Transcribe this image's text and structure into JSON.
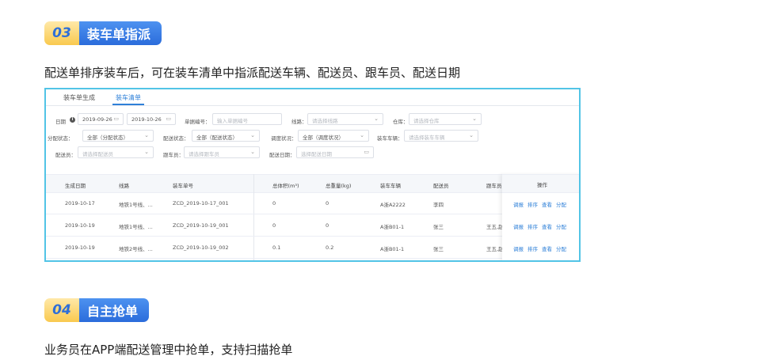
{
  "section3": {
    "num": "03",
    "title": "装车单指派",
    "desc": "配送单排序装车后，可在装车清单中指派配送车辆、配送员、跟车员、配送日期"
  },
  "screenshot": {
    "tabs": [
      "装车单生成",
      "装车清单"
    ],
    "active_tab": 1,
    "filters": {
      "date_label": "日期",
      "date_start": "2019-09-26",
      "date_end": "2019-10-26",
      "order_no_label": "单据编号：",
      "order_no_placeholder": "输入单据编号",
      "route_label": "线路：",
      "route_placeholder": "请选择线路",
      "warehouse_label": "仓库：",
      "warehouse_placeholder": "请选择仓库",
      "assign_status_label": "分配状态：",
      "assign_status_value": "全部（分配状态）",
      "delivery_status_label": "配送状态：",
      "delivery_status_value": "全部（配送状态）",
      "dispatch_status_label": "调度状况：",
      "dispatch_status_value": "全部（调度状况）",
      "vehicle_label": "装车车辆：",
      "vehicle_placeholder": "请选择装车车辆",
      "courier_label": "配送员：",
      "courier_placeholder": "请选择配送员",
      "follower_label": "跟车员：",
      "follower_placeholder": "请选择跟车员",
      "delivery_date_label": "配送日期：",
      "delivery_date_placeholder": "选择配送日期"
    },
    "columns": [
      "生成日期",
      "线路",
      "装车单号",
      "总体积(m³)",
      "总重量(kg)",
      "装车车辆",
      "配送员",
      "跟车员",
      "操作"
    ],
    "rows": [
      {
        "date": "2019-10-17",
        "route": "地铁1号线、...",
        "no": "ZCD_2019-10-17_001",
        "volume": "0",
        "weight": "0",
        "vehicle": "A浙A2222",
        "courier": "李四",
        "follower": ""
      },
      {
        "date": "2019-10-19",
        "route": "地铁1号线、...",
        "no": "ZCD_2019-10-19_001",
        "volume": "0",
        "weight": "0",
        "vehicle": "A浙B01-1",
        "courier": "张三",
        "follower": "王五,赵"
      },
      {
        "date": "2019-10-19",
        "route": "地铁2号线、...",
        "no": "ZCD_2019-10-19_002",
        "volume": "0.1",
        "weight": "0.2",
        "vehicle": "A浙B01-1",
        "courier": "张三",
        "follower": "王五,赵"
      }
    ],
    "ops": [
      "调报",
      "排序",
      "查看",
      "分配"
    ]
  },
  "section4": {
    "num": "04",
    "title": "自主抢单",
    "desc": "业务员在APP端配送管理中抢单，支持扫描抢单"
  }
}
